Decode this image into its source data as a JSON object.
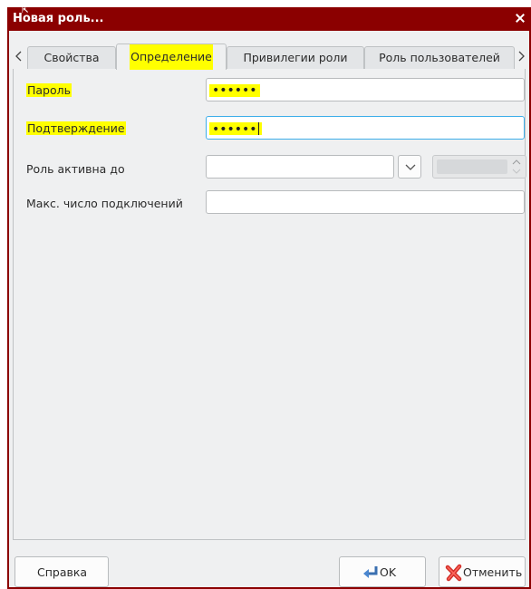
{
  "window": {
    "title": "Новая роль...",
    "close_icon": "close-icon",
    "accent": "#8b0000"
  },
  "tabs": {
    "items": [
      {
        "label": "Свойства"
      },
      {
        "label": "Определение"
      },
      {
        "label": "Привилегии роли"
      },
      {
        "label": "Роль пользователей"
      }
    ],
    "active": "Определение",
    "scroll_left_icon": "chevron-left-icon",
    "scroll_right_icon": "chevron-right-icon"
  },
  "form": {
    "password": {
      "label": "Пароль",
      "value": "••••••"
    },
    "confirm": {
      "label": "Подтверждение",
      "value": "••••••"
    },
    "active_until": {
      "label": "Роль активна до",
      "value": "",
      "dropdown_icon": "chevron-down-icon"
    },
    "max_connections": {
      "label": "Макс. число подключений",
      "value": ""
    }
  },
  "buttons": {
    "help": "Справка",
    "ok": "OK",
    "cancel": "Отменить"
  },
  "colors": {
    "highlight": "#ffff00",
    "focus_border": "#3daee9",
    "background": "#eff0f1"
  }
}
